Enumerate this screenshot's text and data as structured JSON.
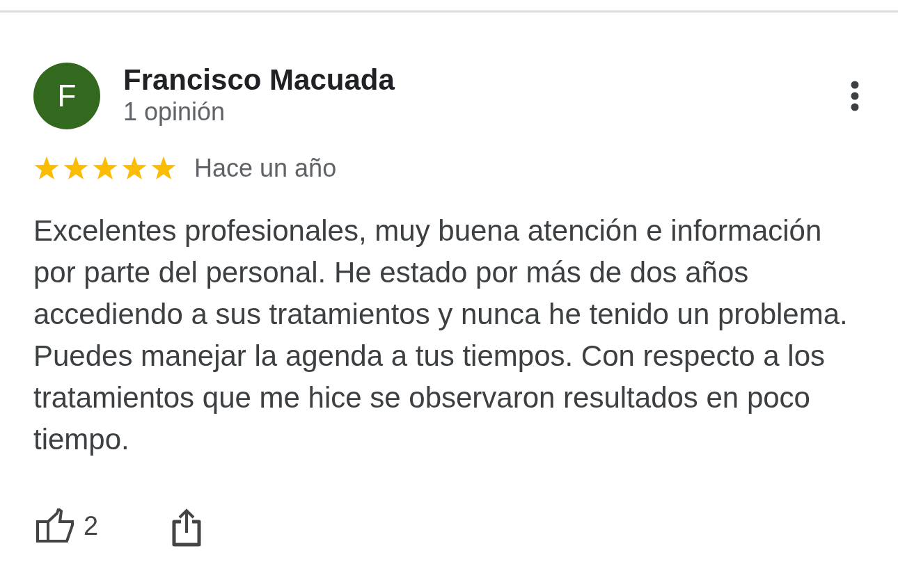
{
  "review": {
    "author": {
      "initial": "F",
      "name": "Francisco Macuada",
      "review_count": "1 opinión"
    },
    "stars": 5,
    "time": "Hace un año",
    "text": "Excelentes profesionales, muy buena atención e información por parte del personal. He estado por más de dos años accediendo a sus tratamientos y nunca he tenido un problema. Puedes manejar la agenda a tus tiempos. Con respecto a los tratamientos que me hice se observaron resultados en poco tiempo.",
    "likes": "2"
  }
}
